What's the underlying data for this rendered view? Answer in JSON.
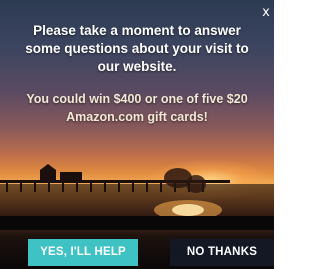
{
  "popup": {
    "close_glyph": "x",
    "question_lines": [
      "Please take a moment to answer",
      "some questions about your visit to",
      "our website."
    ],
    "prize_lines": [
      "You could win $400 or one of five $20",
      "Amazon.com gift cards!"
    ],
    "yes_label": "YES, I'LL HELP",
    "no_label": "NO THANKS"
  },
  "colors": {
    "yes_button": "#3fc2c4",
    "no_button": "#141824"
  },
  "icons": {
    "close": "close-icon"
  }
}
